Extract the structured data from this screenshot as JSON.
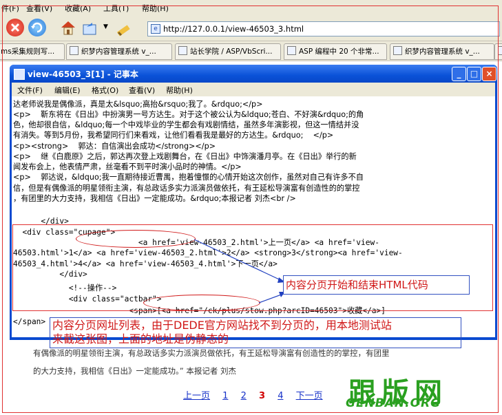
{
  "ie_menu": [
    "件(F)",
    "查看(V)",
    "收藏(A)",
    "工具(T)",
    "帮助(H)"
  ],
  "address": {
    "url": "http://127.0.0.1/view-46503_3.html"
  },
  "tabs": [
    {
      "label": "ms采集规则写..."
    },
    {
      "label": "织梦内容管理系统 v_..."
    },
    {
      "label": "站长学院 / ASP/VbScri..."
    },
    {
      "label": "ASP 编程中 20 个非常..."
    },
    {
      "label": "织梦内容管理系统 v_..."
    }
  ],
  "notepad": {
    "title": "view-46503_3[1] - 记事本",
    "menu": [
      "文件(F)",
      "编辑(E)",
      "格式(O)",
      "查看(V)",
      "帮助(H)"
    ],
    "lines": [
      "达老师说我是偶像派，真是太&lsquo;高抬&rsquo;我了。&rdquo;</p>",
      "<p>    靳东将在《日出》中扮演男一号方达生。对于这个被公认为&ldquo;苍白、不好演&rdquo;的角",
      "色，他却很自信，&ldquo;每一个中戏毕业的学生都会有戏剧情结，虽然多年演影视，但这一情结并没",
      "有消失。等到5月份，我希望同行们来看戏，让他们看看我是最好的方达生。&rdquo;    </p>",
      "<p><strong>    郭达：自信演出会成功</strong></p>",
      "<p>    继《白鹿原》之后，郭达再次登上戏剧舞台，在《日出》中饰演潘月亭。在《日出》举行的新",
      "闻发布会上，他表情严肃，丝毫看不到平时演小品时的神情。</p>",
      "<p>    郭达说，&ldquo;我一直期待接近曹禺，抱着憧憬的心情开始这次创作，虽然对自己有许多不自",
      "信，但是有偶像派的明星领衔主演，有总政话多实力派演员做依托，有王延松导演富有创造性的的掌控",
      "，有团里的大力支持，我相信《日出》一定能成功。&rdquo;本报记者 刘杰<br />"
    ],
    "code_lines": [
      "      </div>",
      "  <div class=\"cupage\">",
      "                           <a href='view-46503_2.html'>上一页</a> <a href='view-",
      "46503.html'>1</a> <a href='view-46503_2.html'>2</a> <strong>3</strong><a href='view-",
      "46503_4.html'>4</a> <a href='view-46503_4.html'>下一页</a>",
      "          </div>",
      "",
      "            <!--操作-->",
      "            <div class=\"actbar\">",
      "                         <span>[<a href=\"/ck/plus/stow.php?arcID=46503\">收藏</a>]",
      "</span>"
    ]
  },
  "annotations": {
    "box1": "内容分页开始和结束HTML代码",
    "box2_line1": "内容分页网址列表，由于DEDE官方网站找不到分页的，用本地测试站",
    "box2_line2": "来截这张图，上面的地址是伪静态的"
  },
  "page": {
    "text_line1": "有偶像派的明星领衔主演，有总政话多实力派演员做依托，有王延松导演富有创造性的的掌控，有团里",
    "text_line2": "的大力支持，我相信《日出》一定能成功。”  本报记者  刘杰",
    "pager": {
      "prev": "上一页",
      "p1": "1",
      "p2": "2",
      "current": "3",
      "p4": "4",
      "next": "下一页"
    }
  },
  "logo": {
    "cn": "跟版网",
    "en": "GENBAN.ORG",
    "color": "#2aa020"
  },
  "colors": {
    "accent_red": "#d01818",
    "xp_blue": "#0a52d8"
  }
}
